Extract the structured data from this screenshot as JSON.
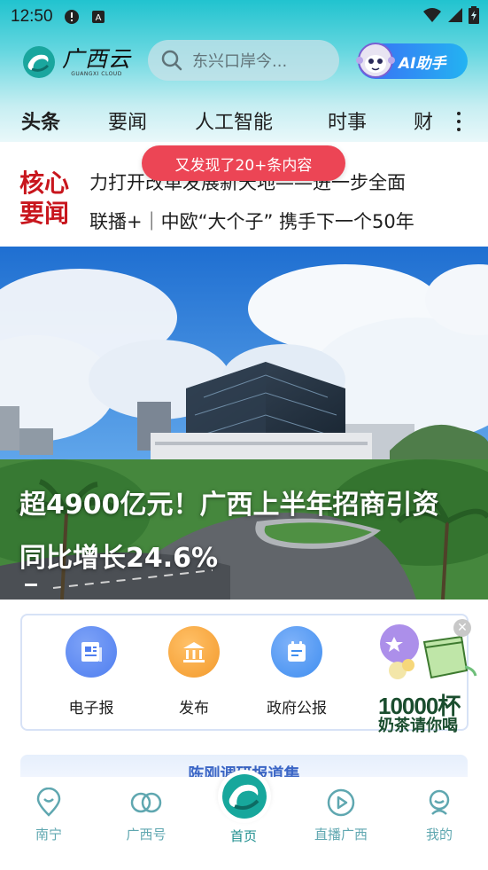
{
  "status_bar": {
    "time": "12:50",
    "left_icons": [
      "alert-icon",
      "a-badge-icon"
    ],
    "right_icons": [
      "wifi-icon",
      "signal-icon",
      "battery-icon"
    ]
  },
  "header": {
    "logo_text": "广西云",
    "logo_subtext": "GUANGXI CLOUD",
    "search_placeholder": "东兴口岸今...",
    "ai_button_label": "AI助手"
  },
  "tabs": [
    {
      "label": "头条",
      "active": true
    },
    {
      "label": "要闻",
      "active": false
    },
    {
      "label": "人工智能",
      "active": false
    },
    {
      "label": "时事",
      "active": false
    },
    {
      "label": "财",
      "active": false
    }
  ],
  "core_news": {
    "label_line1": "核心",
    "label_line2": "要闻",
    "headline1": "力打开改革发展新天地——进一步全面",
    "headline2": "联播+｜中欧“大个子” 携手下一个50年",
    "toast": "又发现了20+条内容"
  },
  "hero": {
    "title": "超4900亿元！广西上半年招商引资同比增长24.6%"
  },
  "services": [
    {
      "label": "电子报",
      "icon": "newspaper-icon",
      "color": "#4f7ef0"
    },
    {
      "label": "发布",
      "icon": "building-icon",
      "color": "#f39a2c"
    },
    {
      "label": "政府公报",
      "icon": "document-icon",
      "color": "#3f8ef0"
    }
  ],
  "promo": {
    "line1": "10000杯",
    "line2": "奶茶请你喝"
  },
  "collection": {
    "title": "陈刚调研报道集"
  },
  "bottom_nav": [
    {
      "label": "南宁",
      "icon": "location-pin-icon",
      "active": false
    },
    {
      "label": "广西号",
      "icon": "link-rings-icon",
      "active": false
    },
    {
      "label": "首页",
      "icon": "home-logo-icon",
      "active": true
    },
    {
      "label": "直播广西",
      "icon": "play-circle-icon",
      "active": false
    },
    {
      "label": "我的",
      "icon": "user-profile-icon",
      "active": false
    }
  ],
  "colors": {
    "header_teal": "#21c3cf",
    "accent_red": "#c8161d",
    "toast_red": "#ec4555",
    "ai_blue": "#3b6cf5",
    "nav_teal": "#5fa7b0"
  }
}
